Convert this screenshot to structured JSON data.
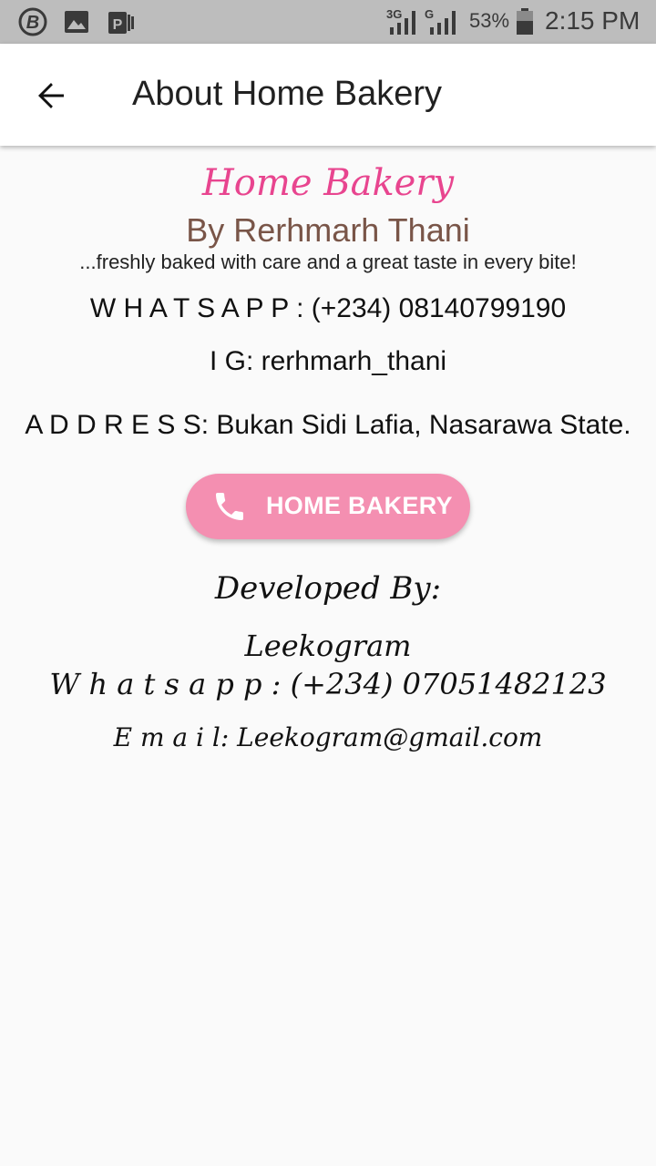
{
  "status_bar": {
    "battery_percent": "53%",
    "time": "2:15 PM",
    "network_1": "3G",
    "network_2": "G",
    "icons": [
      "b-circle-icon",
      "image-icon",
      "p-app-icon",
      "signal-icon",
      "battery-icon"
    ]
  },
  "app_bar": {
    "back_icon": "arrow-left-icon",
    "title": "About Home Bakery"
  },
  "content": {
    "brand": "Home Bakery",
    "owner": "By Rerhmarh Thani",
    "tagline": "...freshly baked with care and a great taste in every bite!",
    "whatsapp": "W H A T S A P P : (+234) 08140799190",
    "instagram": "I G: rerhmarh_thani",
    "address": "A D D R E S S: Bukan Sidi Lafia, Nasarawa State.",
    "call_button": {
      "icon": "phone-icon",
      "label": "HOME BAKERY"
    }
  },
  "developer": {
    "label": "Developed By:",
    "name": "Leekogram",
    "whatsapp": "W h a t s a p p : (+234) 07051482123",
    "email": "E m a i l: Leekogram@gmail.com"
  },
  "colors": {
    "status_bar": "#bdbdbd",
    "app_bar": "#ffffff",
    "background": "#fafafa",
    "brand_pink": "#e8458f",
    "owner_brown": "#795548",
    "button_pink": "#f48fb1"
  }
}
